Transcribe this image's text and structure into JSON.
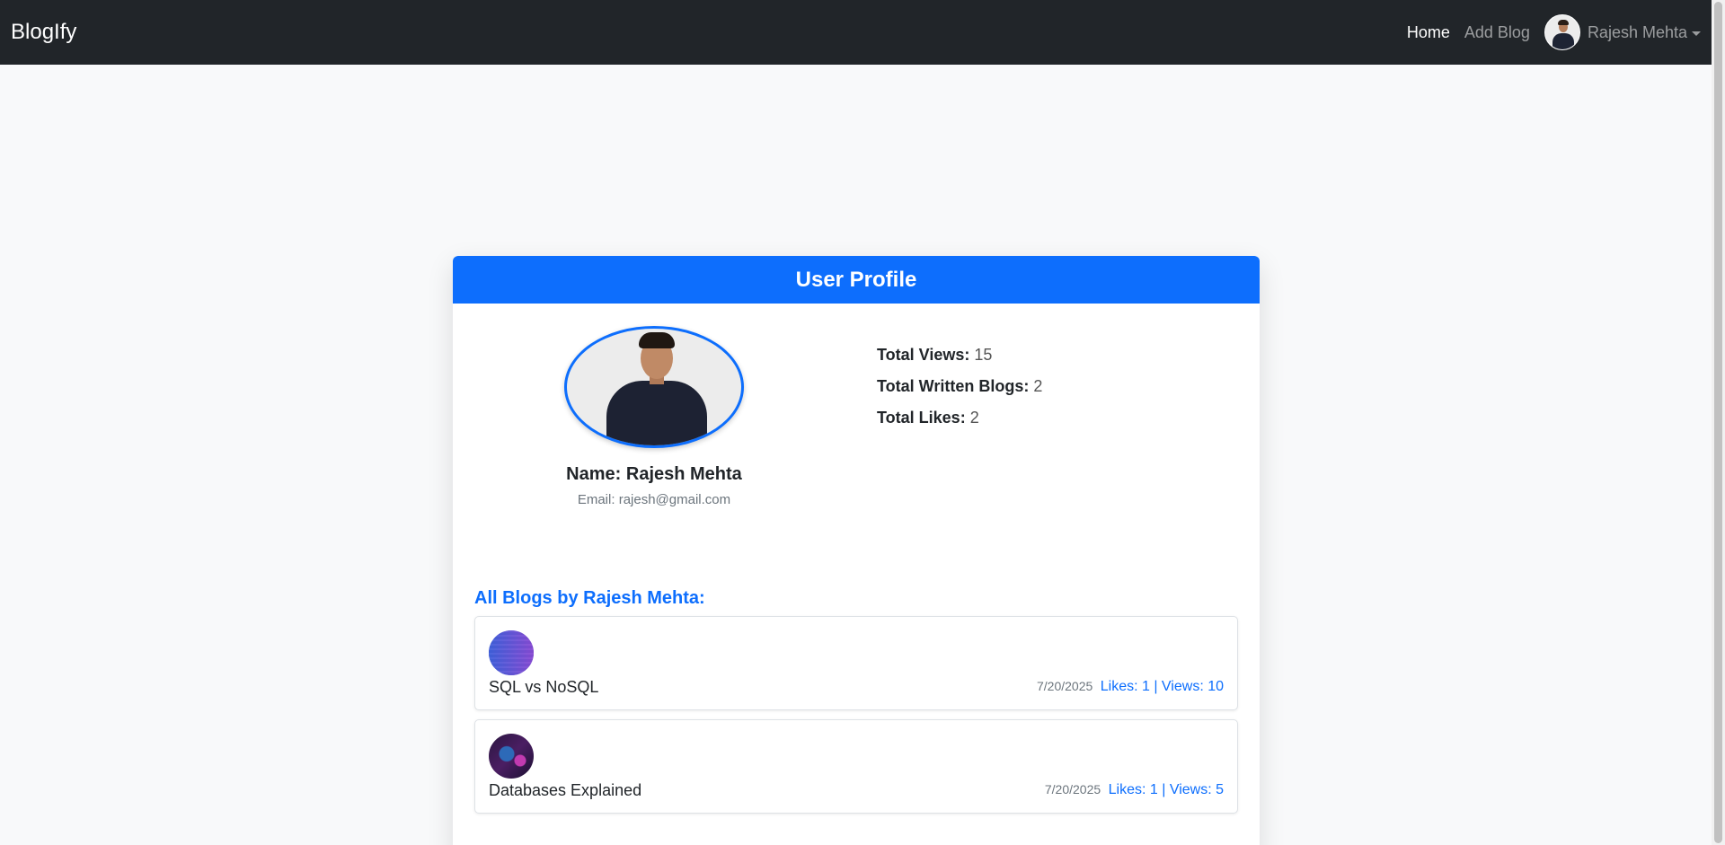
{
  "navbar": {
    "brand": "BlogIfy",
    "links": {
      "home": "Home",
      "add_blog": "Add Blog"
    },
    "user_name": "Rajesh Mehta"
  },
  "card": {
    "header": "User Profile",
    "name_label": "Name:",
    "name": "Rajesh Mehta",
    "email_label": "Email:",
    "email": "rajesh@gmail.com",
    "stats": {
      "views_label": "Total Views:",
      "views": "15",
      "blogs_label": "Total Written Blogs:",
      "blogs": "2",
      "likes_label": "Total Likes:",
      "likes": "2"
    },
    "blogs_heading": "All Blogs by Rajesh Mehta:",
    "blogs": [
      {
        "title": "SQL vs NoSQL",
        "date": "7/20/2025",
        "stats": "Likes: 1 | Views: 10"
      },
      {
        "title": "Databases Explained",
        "date": "7/20/2025",
        "stats": "Likes: 1 | Views: 5"
      }
    ]
  },
  "colors": {
    "primary": "#0d6efd",
    "navbar": "#212529",
    "page_bg": "#f8f9fa"
  }
}
